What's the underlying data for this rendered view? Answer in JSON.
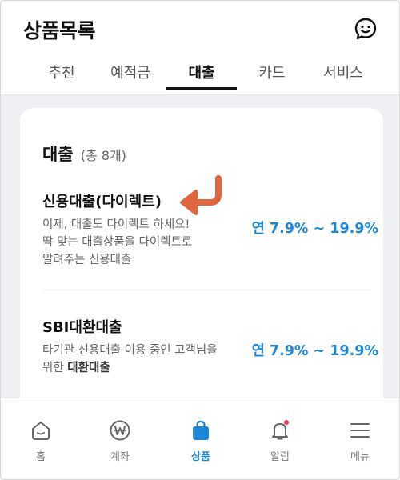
{
  "header": {
    "title": "상품목록",
    "chat_icon": "smiley-chat-icon"
  },
  "tabs": [
    {
      "label": "추천",
      "active": false
    },
    {
      "label": "예적금",
      "active": false
    },
    {
      "label": "대출",
      "active": true
    },
    {
      "label": "카드",
      "active": false
    },
    {
      "label": "서비스",
      "active": false
    }
  ],
  "section": {
    "title": "대출",
    "count": "(총 8개)"
  },
  "products": [
    {
      "name": "신용대출(다이렉트)",
      "desc_line1": "이제, 대출도 다이렉트 하세요!",
      "desc_line2": "딱 맞는 대출상품을 다이렉트로",
      "desc_line3": "알려주는 신용대출",
      "rate": "연 7.9% ~ 19.9%"
    },
    {
      "name": "SBI대환대출",
      "desc_line1": "타기관 신용대출 이용 중인 고객님을",
      "desc_prefix2": "위한 ",
      "desc_bold2": "대환대출",
      "rate": "연 7.9% ~ 19.9%"
    }
  ],
  "bottom_nav": [
    {
      "label": "홈",
      "icon": "home-icon",
      "active": false
    },
    {
      "label": "계좌",
      "icon": "won-coin-icon",
      "active": false
    },
    {
      "label": "상품",
      "icon": "shopping-bag-icon",
      "active": true
    },
    {
      "label": "알림",
      "icon": "bell-icon",
      "active": false,
      "badge": true
    },
    {
      "label": "메뉴",
      "icon": "hamburger-menu-icon",
      "active": false
    }
  ],
  "colors": {
    "accent": "#1e87d6",
    "arrow": "#e0663f",
    "badge": "#e8405c"
  }
}
